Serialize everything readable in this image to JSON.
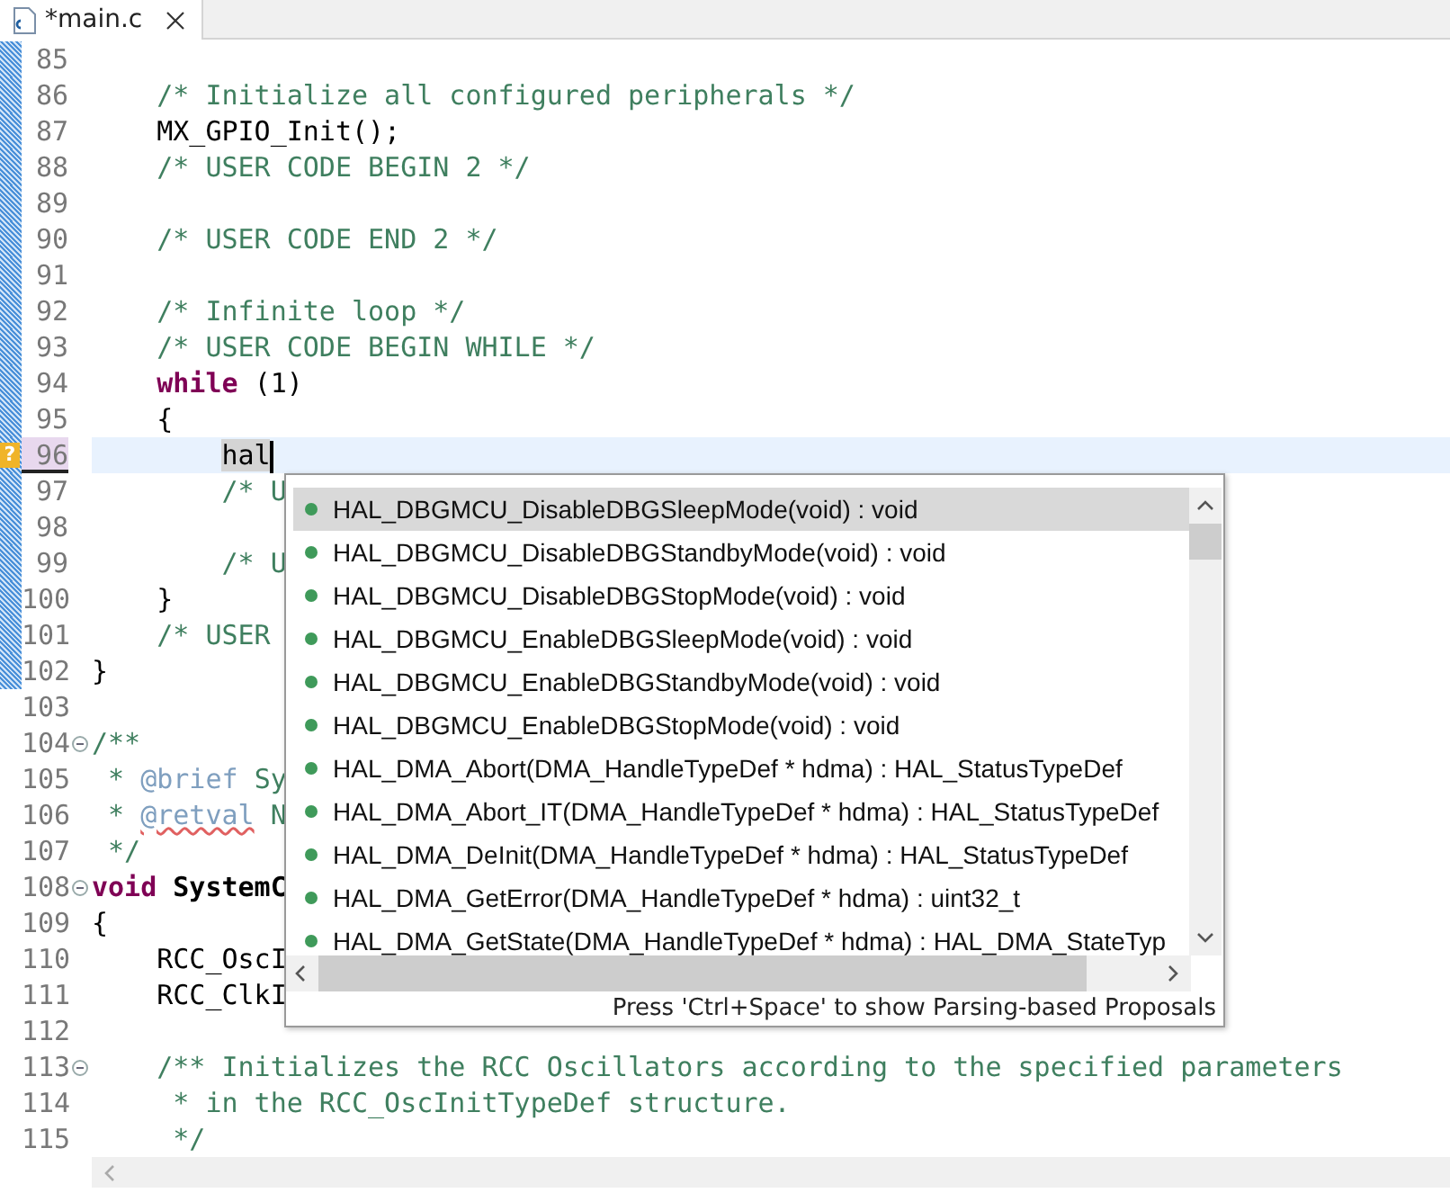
{
  "tab": {
    "title": "*main.c",
    "selected": true
  },
  "editor": {
    "lines": [
      {
        "number": "85",
        "changed": true
      },
      {
        "number": "86",
        "changed": true,
        "segments": [
          {
            "kind": "comment",
            "text": "    /* Initialize all configured peripherals */"
          }
        ]
      },
      {
        "number": "87",
        "changed": true,
        "segments": [
          {
            "kind": "code",
            "text": "    MX_GPIO_Init();"
          }
        ]
      },
      {
        "number": "88",
        "changed": true,
        "segments": [
          {
            "kind": "comment",
            "text": "    /* USER CODE BEGIN 2 */"
          }
        ]
      },
      {
        "number": "89",
        "changed": true
      },
      {
        "number": "90",
        "changed": true,
        "segments": [
          {
            "kind": "comment",
            "text": "    /* USER CODE END 2 */"
          }
        ]
      },
      {
        "number": "91",
        "changed": true
      },
      {
        "number": "92",
        "changed": true,
        "segments": [
          {
            "kind": "comment",
            "text": "    /* Infinite loop */"
          }
        ]
      },
      {
        "number": "93",
        "changed": true,
        "segments": [
          {
            "kind": "comment",
            "text": "    /* USER CODE BEGIN WHILE */"
          }
        ]
      },
      {
        "number": "94",
        "changed": true,
        "segments": [
          {
            "kind": "keyword",
            "text": "    while"
          },
          {
            "kind": "code",
            "text": " (1)"
          }
        ]
      },
      {
        "number": "95",
        "changed": true,
        "segments": [
          {
            "kind": "code",
            "text": "    {"
          }
        ]
      },
      {
        "number": "96",
        "changed": true,
        "current": true,
        "annotation": "?",
        "segments": [
          {
            "kind": "occurrence",
            "text": "        hal"
          }
        ]
      },
      {
        "number": "97",
        "changed": true,
        "segments": [
          {
            "kind": "comment",
            "text": "        /* U"
          }
        ]
      },
      {
        "number": "98",
        "changed": true
      },
      {
        "number": "99",
        "changed": true,
        "segments": [
          {
            "kind": "comment",
            "text": "        /* U"
          }
        ]
      },
      {
        "number": "100",
        "changed": true,
        "segments": [
          {
            "kind": "code",
            "text": "    }"
          }
        ]
      },
      {
        "number": "101",
        "changed": true,
        "segments": [
          {
            "kind": "comment",
            "text": "    /* USER"
          }
        ]
      },
      {
        "number": "102",
        "changed": true,
        "segments": [
          {
            "kind": "code",
            "text": "}"
          }
        ]
      },
      {
        "number": "103",
        "changed": false
      },
      {
        "number": "104",
        "changed": false,
        "fold": true,
        "segments": [
          {
            "kind": "comment",
            "text": "/**"
          }
        ]
      },
      {
        "number": "105",
        "changed": false,
        "segments": [
          {
            "kind": "comment",
            "text": " *"
          },
          {
            "kind": "doctag",
            "text": " @brief"
          },
          {
            "kind": "comment",
            "text": " Sy"
          }
        ]
      },
      {
        "number": "106",
        "changed": false,
        "segments": [
          {
            "kind": "comment",
            "text": " *"
          },
          {
            "kind": "doctag-warning",
            "text": " @retval"
          },
          {
            "kind": "comment",
            "text": " N"
          }
        ]
      },
      {
        "number": "107",
        "changed": false,
        "segments": [
          {
            "kind": "comment",
            "text": " */"
          }
        ]
      },
      {
        "number": "108",
        "changed": false,
        "fold": true,
        "segments": [
          {
            "kind": "keyword",
            "text": "void"
          },
          {
            "kind": "bold",
            "text": " SystemC"
          }
        ]
      },
      {
        "number": "109",
        "changed": false,
        "segments": [
          {
            "kind": "code",
            "text": "{"
          }
        ]
      },
      {
        "number": "110",
        "changed": false,
        "segments": [
          {
            "kind": "code",
            "text": "    RCC_OscI"
          }
        ]
      },
      {
        "number": "111",
        "changed": false,
        "segments": [
          {
            "kind": "code",
            "text": "    RCC_ClkI"
          }
        ]
      },
      {
        "number": "112",
        "changed": false
      },
      {
        "number": "113",
        "changed": false,
        "fold": true,
        "segments": [
          {
            "kind": "comment",
            "text": "    /** Initializes the RCC Oscillators according to the specified parameters"
          }
        ]
      },
      {
        "number": "114",
        "changed": false,
        "segments": [
          {
            "kind": "comment",
            "text": "     * in the RCC_OscInitTypeDef structure."
          }
        ]
      },
      {
        "number": "115",
        "changed": false,
        "segments": [
          {
            "kind": "comment",
            "text": "     */"
          }
        ]
      }
    ]
  },
  "completion": {
    "items": [
      {
        "text": "HAL_DBGMCU_DisableDBGSleepMode(void) : void",
        "selected": true
      },
      {
        "text": "HAL_DBGMCU_DisableDBGStandbyMode(void) : void",
        "selected": false
      },
      {
        "text": "HAL_DBGMCU_DisableDBGStopMode(void) : void",
        "selected": false
      },
      {
        "text": "HAL_DBGMCU_EnableDBGSleepMode(void) : void",
        "selected": false
      },
      {
        "text": "HAL_DBGMCU_EnableDBGStandbyMode(void) : void",
        "selected": false
      },
      {
        "text": "HAL_DBGMCU_EnableDBGStopMode(void) : void",
        "selected": false
      },
      {
        "text": "HAL_DMA_Abort(DMA_HandleTypeDef * hdma) : HAL_StatusTypeDef",
        "selected": false
      },
      {
        "text": "HAL_DMA_Abort_IT(DMA_HandleTypeDef * hdma) : HAL_StatusTypeDef",
        "selected": false
      },
      {
        "text": "HAL_DMA_DeInit(DMA_HandleTypeDef * hdma) : HAL_StatusTypeDef",
        "selected": false
      },
      {
        "text": "HAL_DMA_GetError(DMA_HandleTypeDef * hdma) : uint32_t",
        "selected": false
      },
      {
        "text": "HAL_DMA_GetState(DMA_HandleTypeDef * hdma) : HAL_DMA_StateTyp",
        "selected": false
      }
    ],
    "hint": "Press 'Ctrl+Space' to show Parsing-based Proposals"
  }
}
